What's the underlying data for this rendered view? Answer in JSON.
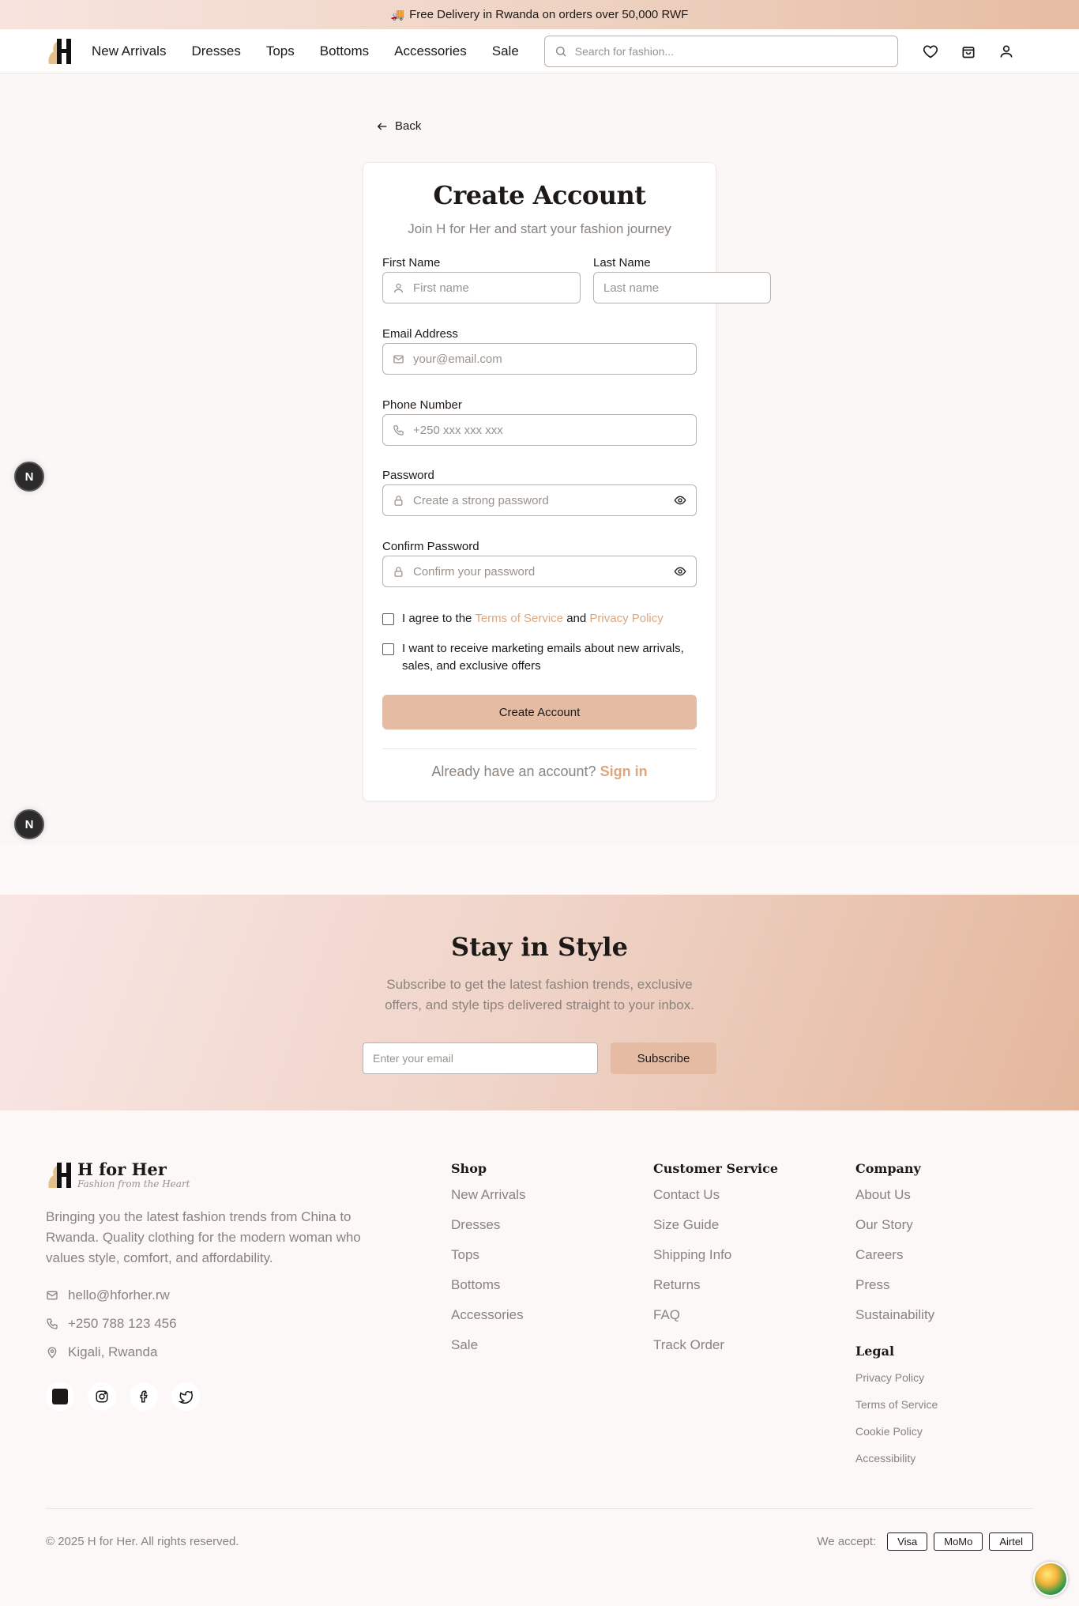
{
  "announcement": {
    "icon": "truck-icon",
    "text": "Free Delivery in Rwanda on orders over 50,000 RWF"
  },
  "header": {
    "nav": [
      "New Arrivals",
      "Dresses",
      "Tops",
      "Bottoms",
      "Accessories",
      "Sale"
    ],
    "search_placeholder": "Search for fashion...",
    "icons": [
      "heart-icon",
      "shopping-bag-icon",
      "user-icon"
    ]
  },
  "back_label": "Back",
  "form": {
    "title": "Create Account",
    "subtitle": "Join H for Her and start your fashion journey",
    "first_name": {
      "label": "First Name",
      "placeholder": "First name"
    },
    "last_name": {
      "label": "Last Name",
      "placeholder": "Last name"
    },
    "email": {
      "label": "Email Address",
      "placeholder": "your@email.com"
    },
    "phone": {
      "label": "Phone Number",
      "placeholder": "+250 xxx xxx xxx"
    },
    "password": {
      "label": "Password",
      "placeholder": "Create a strong password"
    },
    "confirm_password": {
      "label": "Confirm Password",
      "placeholder": "Confirm your password"
    },
    "terms": {
      "prefix": "I agree to the",
      "tos": "Terms of Service",
      "and": "and",
      "privacy": "Privacy Policy",
      "checked": false
    },
    "marketing": {
      "text": "I want to receive marketing emails about new arrivals, sales, and exclusive offers",
      "checked": false
    },
    "submit_label": "Create Account",
    "signin_prompt": "Already have an account?",
    "signin_link": "Sign in"
  },
  "badge_letter": "N",
  "newsletter": {
    "title": "Stay in Style",
    "subtitle_line1": "Subscribe to get the latest fashion trends, exclusive",
    "subtitle_line2": "offers, and style tips delivered straight to your inbox.",
    "placeholder": "Enter your email",
    "button": "Subscribe"
  },
  "footer": {
    "brand_name": "H for Her",
    "tagline": "Fashion from the Heart",
    "description": "Bringing you the latest fashion trends from China to Rwanda. Quality clothing for the modern woman who values style, comfort, and affordability.",
    "email": "hello@hforher.rw",
    "phone": "+250 788 123 456",
    "location": "Kigali, Rwanda",
    "socials": [
      "tiktok-icon",
      "instagram-icon",
      "facebook-icon",
      "twitter-icon"
    ],
    "shop": {
      "title": "Shop",
      "links": [
        "New Arrivals",
        "Dresses",
        "Tops",
        "Bottoms",
        "Accessories",
        "Sale"
      ]
    },
    "service": {
      "title": "Customer Service",
      "links": [
        "Contact Us",
        "Size Guide",
        "Shipping Info",
        "Returns",
        "FAQ",
        "Track Order"
      ]
    },
    "company": {
      "title": "Company",
      "links": [
        "About Us",
        "Our Story",
        "Careers",
        "Press",
        "Sustainability"
      ]
    },
    "legal": {
      "title": "Legal",
      "links": [
        "Privacy Policy",
        "Terms of Service",
        "Cookie Policy",
        "Accessibility"
      ]
    },
    "copyright": "© 2025 H for Her. All rights reserved.",
    "we_accept": "We accept:",
    "payments": [
      "Visa",
      "MoMo",
      "Airtel"
    ]
  },
  "colors": {
    "accent": "#dca77f",
    "button": "#e5bca3",
    "announcement_start": "#f7e4de",
    "announcement_end": "#e6bca2"
  }
}
